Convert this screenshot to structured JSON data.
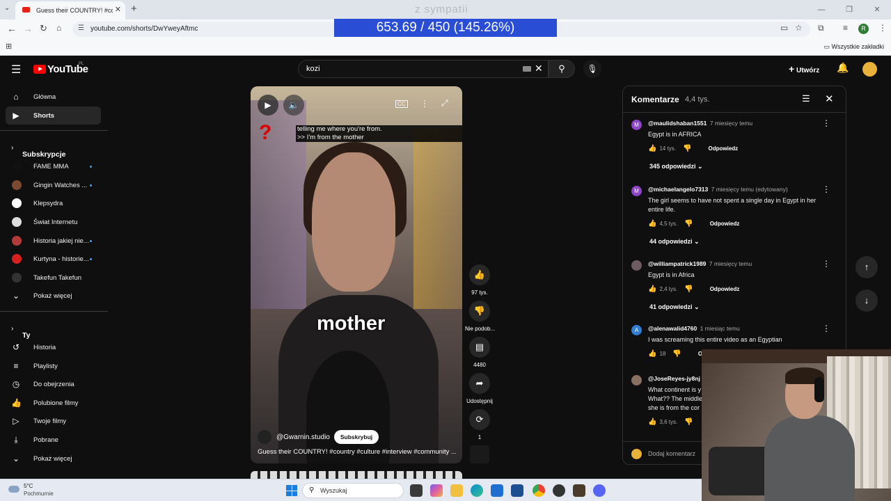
{
  "browser": {
    "tab_title": "Guess their COUNTRY! #country",
    "url": "youtube.com/shorts/DwYweyAftmc",
    "bookmarks_all": "Wszystkie zakładki",
    "profile_letter": "R"
  },
  "overlay": {
    "score": "653.69 / 450 (145.26%)",
    "sympathy": "z sympatii"
  },
  "youtube": {
    "logo": "YouTube",
    "region": "PL",
    "search_query": "kozi",
    "create_label": "Utwórz"
  },
  "sidebar": {
    "main": [
      {
        "label": "Główna",
        "icon": "home-icon"
      },
      {
        "label": "Shorts",
        "icon": "shorts-icon"
      }
    ],
    "subscriptions_title": "Subskrypcje",
    "subscriptions": [
      {
        "label": "FAME MMA",
        "color": "#111111",
        "dot": true
      },
      {
        "label": "Gingin Watches ...",
        "color": "#7a4b32",
        "dot": true
      },
      {
        "label": "Klepsydra",
        "color": "#ffffff",
        "dot": false
      },
      {
        "label": "Świat Internetu",
        "color": "#dddddd",
        "dot": false
      },
      {
        "label": "Historia jakiej nie...",
        "color": "#b33a3a",
        "dot": true
      },
      {
        "label": "Kurtyna - historie...",
        "color": "#d62020",
        "dot": true
      },
      {
        "label": "Takefun Takefun",
        "color": "#333333",
        "dot": false
      }
    ],
    "show_more_1": "Pokaż więcej",
    "you_title": "Ty",
    "you": [
      {
        "label": "Historia",
        "icon": "history-icon"
      },
      {
        "label": "Playlisty",
        "icon": "playlist-icon"
      },
      {
        "label": "Do obejrzenia",
        "icon": "clock-icon"
      },
      {
        "label": "Polubione filmy",
        "icon": "thumbs-up-icon"
      },
      {
        "label": "Twoje filmy",
        "icon": "video-icon"
      },
      {
        "label": "Pobrane",
        "icon": "download-icon"
      }
    ],
    "show_more_2": "Pokaż więcej"
  },
  "video": {
    "subtitle_line1": "telling me where you're from.",
    "subtitle_line2": ">> I'm from the mother",
    "caption": "mother",
    "cc": "CC",
    "channel": "@Gwarnin.studio",
    "subscribe": "Subskrybuj",
    "title": "Guess their COUNTRY! #country #culture #interview #community ..."
  },
  "actions": {
    "likes": "97 tys.",
    "dislike": "Nie podob...",
    "comments": "4480",
    "share": "Udostępnij",
    "remix": "1"
  },
  "comments": {
    "title": "Komentarze",
    "count": "4,4 tys.",
    "items": [
      {
        "user": "@maulidshaban1551",
        "time": "7 miesięcy temu",
        "avatar": "M",
        "color": "#8e44c9",
        "text": "Egypt is in AFRICA",
        "likes": "14 tys.",
        "reply": "Odpowiedz",
        "replies": "345 odpowiedzi"
      },
      {
        "user": "@michaelangelo7313",
        "time": "7 miesięcy temu (edytowany)",
        "avatar": "M",
        "color": "#8e44c9",
        "text": "The girl seems to have not spent a single day in Egypt in her entire life.",
        "likes": "4,5 tys.",
        "reply": "Odpowiedz",
        "replies": "44 odpowiedzi"
      },
      {
        "user": "@williampatrick1989",
        "time": "7 miesięcy temu",
        "avatar": "",
        "color": "#6d5b62",
        "text": "Egypt is in Africa",
        "likes": "2,4 tys.",
        "reply": "Odpowiedz",
        "replies": "41 odpowiedzi"
      },
      {
        "user": "@alenawalid4760",
        "time": "1 miesiąc temu",
        "avatar": "A",
        "color": "#2f7fd6",
        "text": "I was screaming this entire video as an Egyptian",
        "likes": "18",
        "reply": "Odpowiedz",
        "replies": ""
      },
      {
        "user": "@JoseReyes-jy8nj",
        "time": "7",
        "avatar": "",
        "color": "#8a7060",
        "text": "What continent is y\nWhat?? The middle\nshe is from the cor",
        "likes": "3,6 tys.",
        "reply": "",
        "replies": ""
      }
    ],
    "add_placeholder": "Dodaj komentarz"
  },
  "taskbar": {
    "temp": "5°C",
    "weather": "Pochmurnie",
    "search_placeholder": "Wyszukaj"
  }
}
